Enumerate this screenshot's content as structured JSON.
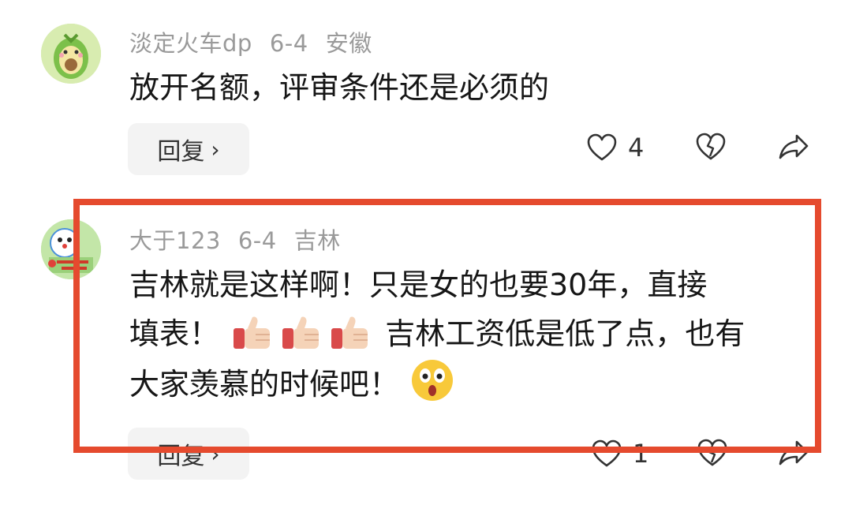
{
  "comments": [
    {
      "username": "淡定火车dp",
      "date": "6-4",
      "location": "安徽",
      "text": "放开名额，评审条件还是必须的",
      "reply_label": "回复",
      "like_count": "4"
    },
    {
      "username": "大于123",
      "date": "6-4",
      "location": "吉林",
      "text_line1": "吉林就是这样啊！只是女的也要30年，直接",
      "text_line2_a": "填表！",
      "text_line2_b": "吉林工资低是低了点，也有",
      "text_line3": "大家羡慕的时候吧！",
      "reply_label": "回复",
      "like_count": "1"
    }
  ],
  "colors": {
    "highlight_border": "#e54a2e",
    "meta_text": "#9a9a9a",
    "reply_bg": "#f3f3f3"
  },
  "icons": [
    "heart-icon",
    "broken-heart-icon",
    "share-icon",
    "thumbs-up-emoji",
    "astonished-emoji",
    "avocado-avatar"
  ]
}
